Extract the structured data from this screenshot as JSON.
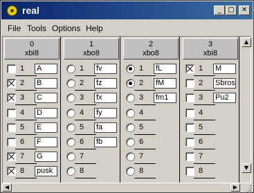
{
  "window": {
    "title": "real"
  },
  "menu": [
    "File",
    "Tools",
    "Options",
    "Help"
  ],
  "titlebar_buttons": {
    "minimize": "_",
    "maximize": "□",
    "close": "✕"
  },
  "columns": [
    {
      "index": "0",
      "type": "xbi8",
      "control": "checkbox",
      "rows": [
        {
          "num": "1",
          "checked": false,
          "value": "A"
        },
        {
          "num": "2",
          "checked": true,
          "value": "B"
        },
        {
          "num": "3",
          "checked": true,
          "value": "C"
        },
        {
          "num": "4",
          "checked": false,
          "value": "D"
        },
        {
          "num": "5",
          "checked": false,
          "value": "E"
        },
        {
          "num": "6",
          "checked": false,
          "value": "F"
        },
        {
          "num": "7",
          "checked": true,
          "value": "G"
        },
        {
          "num": "8",
          "checked": true,
          "value": "pusk"
        }
      ]
    },
    {
      "index": "1",
      "type": "xbo8",
      "control": "radio",
      "rows": [
        {
          "num": "1",
          "checked": false,
          "value": "fv"
        },
        {
          "num": "2",
          "checked": false,
          "value": "fz"
        },
        {
          "num": "3",
          "checked": false,
          "value": "fx"
        },
        {
          "num": "4",
          "checked": false,
          "value": "fy"
        },
        {
          "num": "5",
          "checked": false,
          "value": "fa"
        },
        {
          "num": "6",
          "checked": false,
          "value": "fb"
        },
        {
          "num": "7",
          "checked": false,
          "value": ""
        },
        {
          "num": "8",
          "checked": false,
          "value": ""
        }
      ]
    },
    {
      "index": "2",
      "type": "xbo8",
      "control": "radio",
      "rows": [
        {
          "num": "1",
          "checked": true,
          "value": "fL"
        },
        {
          "num": "2",
          "checked": true,
          "value": "fM"
        },
        {
          "num": "3",
          "checked": false,
          "value": "fm1"
        },
        {
          "num": "4",
          "checked": false,
          "value": ""
        },
        {
          "num": "5",
          "checked": false,
          "value": ""
        },
        {
          "num": "6",
          "checked": false,
          "value": ""
        },
        {
          "num": "7",
          "checked": false,
          "value": ""
        },
        {
          "num": "8",
          "checked": false,
          "value": ""
        }
      ]
    },
    {
      "index": "3",
      "type": "xbi8",
      "control": "checkbox",
      "rows": [
        {
          "num": "1",
          "checked": true,
          "value": "M"
        },
        {
          "num": "2",
          "checked": false,
          "value": "Sbros"
        },
        {
          "num": "3",
          "checked": false,
          "value": "Pu2"
        },
        {
          "num": "4",
          "checked": false,
          "value": ""
        },
        {
          "num": "5",
          "checked": false,
          "value": ""
        },
        {
          "num": "6",
          "checked": false,
          "value": ""
        },
        {
          "num": "7",
          "checked": false,
          "value": ""
        },
        {
          "num": "8",
          "checked": false,
          "value": ""
        }
      ]
    }
  ],
  "scrollbar_arrows": {
    "up": "▲",
    "down": "▼",
    "left": "◀",
    "right": "▶"
  }
}
